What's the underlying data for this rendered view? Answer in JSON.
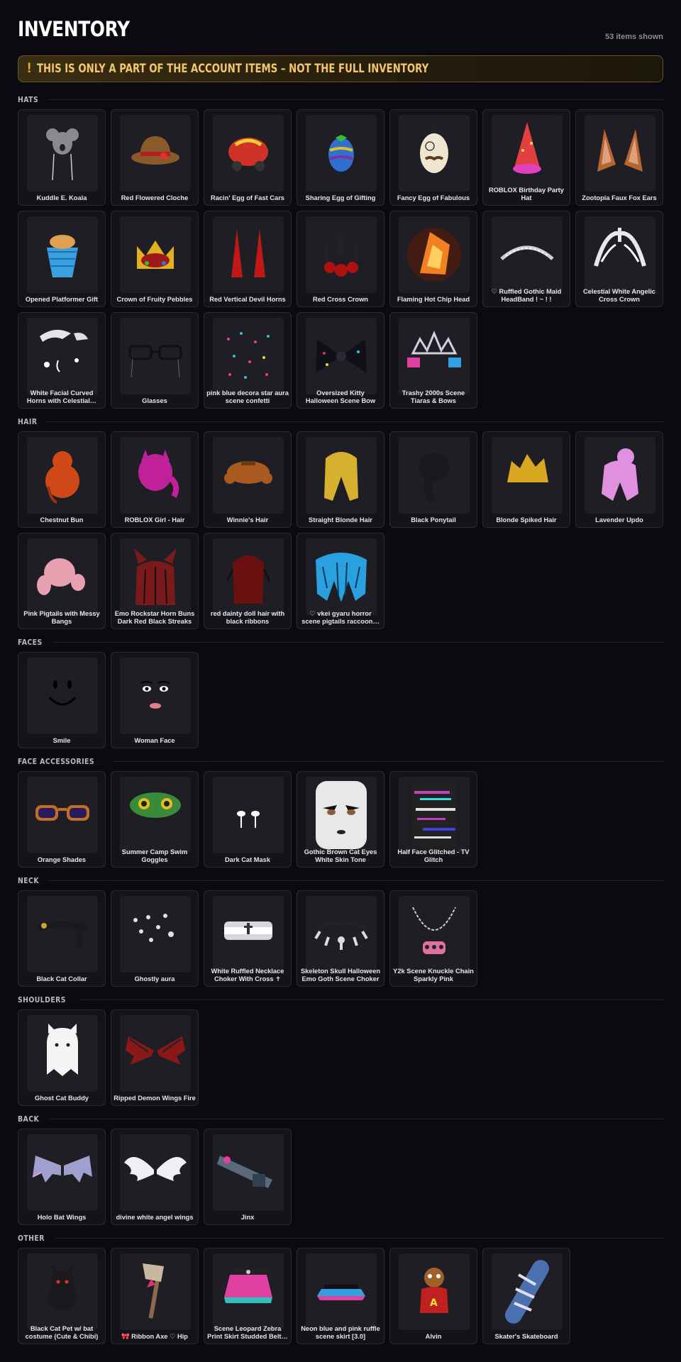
{
  "header": {
    "title": "INVENTORY",
    "item_count": "53 items shown"
  },
  "banner": {
    "icon": "exclamation-icon",
    "text": "THIS IS ONLY A PART OF THE ACCOUNT ITEMS – NOT THE FULL INVENTORY",
    "accent": "#f0b429"
  },
  "sections": [
    {
      "title": "HATS",
      "items": [
        {
          "name": "Kuddle E. Koala",
          "icon": "koala-hat",
          "color": "#8a8a8e"
        },
        {
          "name": "Red Flowered Cloche",
          "icon": "cloche-hat",
          "color": "#8a5a2a"
        },
        {
          "name": "Racin' Egg of Fast Cars",
          "icon": "egg-car",
          "color": "#d03228"
        },
        {
          "name": "Sharing Egg of Gifting",
          "icon": "egg-gift",
          "color": "#2f6fd0"
        },
        {
          "name": "Fancy Egg of Fabulous",
          "icon": "egg-fancy",
          "color": "#efe6d2"
        },
        {
          "name": "ROBLOX Birthday Party Hat",
          "icon": "party-hat",
          "color": "#e04040"
        },
        {
          "name": "Zootopia Faux Fox Ears",
          "icon": "fox-ears",
          "color": "#b7662e"
        },
        {
          "name": "Opened Platformer Gift",
          "icon": "gift-basket",
          "color": "#3aa0e0"
        },
        {
          "name": "Crown of Fruity Pebbles",
          "icon": "crown",
          "color": "#e0b020"
        },
        {
          "name": "Red Vertical Devil Horns",
          "icon": "devil-horns",
          "color": "#c01818"
        },
        {
          "name": "Red Cross Crown",
          "icon": "cross-crown",
          "color": "#b01010"
        },
        {
          "name": "Flaming Hot Chip Head",
          "icon": "flaming-chip",
          "color": "#f08020"
        },
        {
          "name": "♡ Ruffled Gothic Maid HeadBand ! ~ ! !",
          "icon": "headband",
          "color": "#cfcfd4"
        },
        {
          "name": "Celestial White Angelic Cross Crown",
          "icon": "angelic-crown",
          "color": "#e8e8ec"
        },
        {
          "name": "White Facial Curved Horns with Celestial…",
          "icon": "curved-horns",
          "color": "#e4e4ea"
        },
        {
          "name": "Glasses",
          "icon": "glasses",
          "color": "#101014"
        },
        {
          "name": "pink blue decora star aura scene confetti",
          "icon": "confetti",
          "color": "#e040a0"
        },
        {
          "name": "Oversized Kitty Halloween Scene Bow",
          "icon": "bow",
          "color": "#101018"
        },
        {
          "name": "Trashy 2000s Scene Tiaras & Bows",
          "icon": "tiara",
          "color": "#d0d0e0"
        }
      ]
    },
    {
      "title": "HAIR",
      "items": [
        {
          "name": "Chestnut Bun",
          "icon": "hair-bun",
          "color": "#d04818"
        },
        {
          "name": "ROBLOX Girl - Hair",
          "icon": "hair-girl",
          "color": "#c0209a"
        },
        {
          "name": "Winnie's Hair",
          "icon": "hair-winnie",
          "color": "#a85a20"
        },
        {
          "name": "Straight Blonde Hair",
          "icon": "hair-straight",
          "color": "#d8b030"
        },
        {
          "name": "Black Ponytail",
          "icon": "hair-ponytail",
          "color": "#1a1a1e"
        },
        {
          "name": "Blonde Spiked Hair",
          "icon": "hair-spiked",
          "color": "#d8a820"
        },
        {
          "name": "Lavender Updo",
          "icon": "hair-updo",
          "color": "#e090e0"
        },
        {
          "name": "Pink Pigtails with Messy Bangs",
          "icon": "hair-pigtails",
          "color": "#e8a0b0"
        },
        {
          "name": "Emo Rockstar Horn Buns Dark Red Black Streaks",
          "icon": "hair-emo",
          "color": "#7a1a1a"
        },
        {
          "name": "red dainty doll hair with black ribbons",
          "icon": "hair-doll",
          "color": "#6a1010"
        },
        {
          "name": "♡ vkei gyaru horror scene pigtails raccoon…",
          "icon": "hair-vkei",
          "color": "#2aa0e0"
        }
      ]
    },
    {
      "title": "FACES",
      "items": [
        {
          "name": "Smile",
          "icon": "face-smile",
          "color": "#000000"
        },
        {
          "name": "Woman Face",
          "icon": "face-woman",
          "color": "#000000"
        }
      ]
    },
    {
      "title": "FACE ACCESSORIES",
      "items": [
        {
          "name": "Orange Shades",
          "icon": "shades",
          "color": "#c07020"
        },
        {
          "name": "Summer Camp Swim Goggles",
          "icon": "goggles",
          "color": "#3a8a3a"
        },
        {
          "name": "Dark Cat Mask",
          "icon": "cat-mask",
          "color": "#202024"
        },
        {
          "name": "Gothic Brown Cat Eyes White Skin Tone",
          "icon": "gothic-face",
          "color": "#e8e8e8"
        },
        {
          "name": "Half Face Glitched - TV Glitch",
          "icon": "glitch",
          "color": "#c040c0"
        }
      ]
    },
    {
      "title": "NECK",
      "items": [
        {
          "name": "Black Cat Collar",
          "icon": "collar",
          "color": "#1a1a1e"
        },
        {
          "name": "Ghostly aura",
          "icon": "ghost-aura",
          "color": "#e0e0e0"
        },
        {
          "name": "White Ruffled Necklace Choker With Cross ✝",
          "icon": "choker",
          "color": "#d8d8dc"
        },
        {
          "name": "Skeleton Skull Halloween Emo Goth Scene Choker",
          "icon": "skull-choker",
          "color": "#dcdcdc"
        },
        {
          "name": "Y2k Scene Knuckle Chain Sparkly Pink",
          "icon": "knuckle-chain",
          "color": "#e070a0"
        }
      ]
    },
    {
      "title": "SHOULDERS",
      "items": [
        {
          "name": "Ghost Cat Buddy",
          "icon": "ghost-cat",
          "color": "#f4f4f4"
        },
        {
          "name": "Ripped Demon Wings Fire",
          "icon": "demon-wings",
          "color": "#8a1818"
        }
      ]
    },
    {
      "title": "BACK",
      "items": [
        {
          "name": "Holo Bat Wings",
          "icon": "bat-wings",
          "color": "#a0a0d0"
        },
        {
          "name": "divine white angel wings",
          "icon": "angel-wings",
          "color": "#f0f0f4"
        },
        {
          "name": "Jinx",
          "icon": "jinx-gun",
          "color": "#5a6a7a"
        }
      ]
    },
    {
      "title": "OTHER",
      "items": [
        {
          "name": "Black Cat Pet w/ bat costume (Cute & Chibi)",
          "icon": "cat-pet",
          "color": "#1a1a1e"
        },
        {
          "name": "🎀 Ribbon Axe ♡ Hip",
          "icon": "axe",
          "color": "#c8b8a0"
        },
        {
          "name": "Scene Leopard Zebra Print Skirt Studded Belt…",
          "icon": "skirt",
          "color": "#e040a0"
        },
        {
          "name": "Neon blue and pink ruffle scene skirt [3.0]",
          "icon": "ruffle-skirt",
          "color": "#30a0e0"
        },
        {
          "name": "Alvin",
          "icon": "alvin",
          "color": "#c02020"
        },
        {
          "name": "Skater's Skateboard",
          "icon": "skateboard",
          "color": "#4a70b0"
        }
      ]
    }
  ]
}
